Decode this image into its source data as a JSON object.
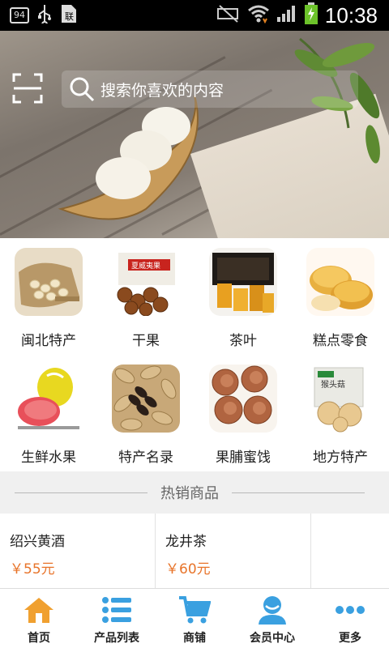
{
  "status_bar": {
    "notification_badge": "94",
    "usb_icon": "usb-icon",
    "sim_icon": "sim-icon",
    "time": "10:38"
  },
  "search": {
    "placeholder": "搜索你喜欢的内容"
  },
  "banner": {
    "dot_count": 6,
    "active_dot": 4
  },
  "categories": [
    {
      "label": "闽北特产",
      "icon": "lotus-seeds-image"
    },
    {
      "label": "干果",
      "icon": "macadamia-nuts-image"
    },
    {
      "label": "茶叶",
      "icon": "tea-box-image"
    },
    {
      "label": "糕点零食",
      "icon": "pastry-image"
    },
    {
      "label": "生鲜水果",
      "icon": "pomelo-image"
    },
    {
      "label": "特产名录",
      "icon": "peanuts-image"
    },
    {
      "label": "果脯蜜饯",
      "icon": "dried-persimmon-image"
    },
    {
      "label": "地方特产",
      "icon": "mushroom-pack-image"
    }
  ],
  "hot": {
    "title": "热销商品"
  },
  "products": [
    {
      "name": "绍兴黄酒",
      "price": "￥55元"
    },
    {
      "name": "龙井茶",
      "price": "￥60元"
    }
  ],
  "bottom_nav": [
    {
      "label": "首页",
      "icon": "home-icon"
    },
    {
      "label": "产品列表",
      "icon": "list-icon"
    },
    {
      "label": "商铺",
      "icon": "cart-icon"
    },
    {
      "label": "会员中心",
      "icon": "user-icon"
    },
    {
      "label": "更多",
      "icon": "more-icon"
    }
  ],
  "colors": {
    "accent_blue": "#3aa0e0",
    "price_orange": "#e8742a",
    "home_orange": "#f0a030"
  }
}
